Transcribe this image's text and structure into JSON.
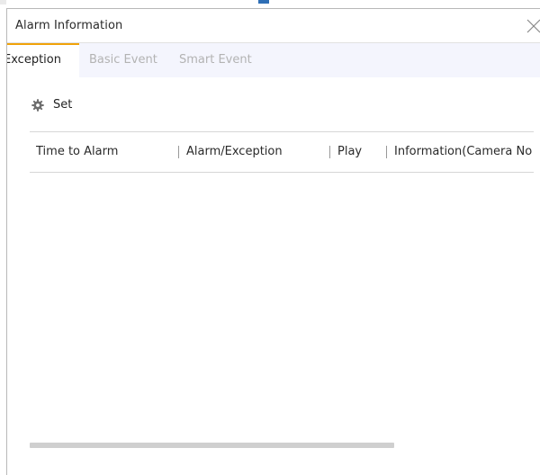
{
  "dialog": {
    "title": "Alarm Information",
    "close_icon": "close-x-icon"
  },
  "tabs": [
    {
      "label": "Exception",
      "active": true
    },
    {
      "label": "Basic Event",
      "active": false
    },
    {
      "label": "Smart Event",
      "active": false
    }
  ],
  "toolbar": {
    "set_label": "Set",
    "set_icon": "gear-icon"
  },
  "table": {
    "columns": [
      "Time to Alarm",
      "Alarm/Exception",
      "Play",
      "Information(Camera No"
    ],
    "rows": []
  },
  "colors": {
    "active_tab_accent": "#f0a30a",
    "tabbar_bg": "#f4f5fd",
    "inactive_tab_text": "#b3b3b3",
    "top_marker": "#2f6fb6"
  }
}
